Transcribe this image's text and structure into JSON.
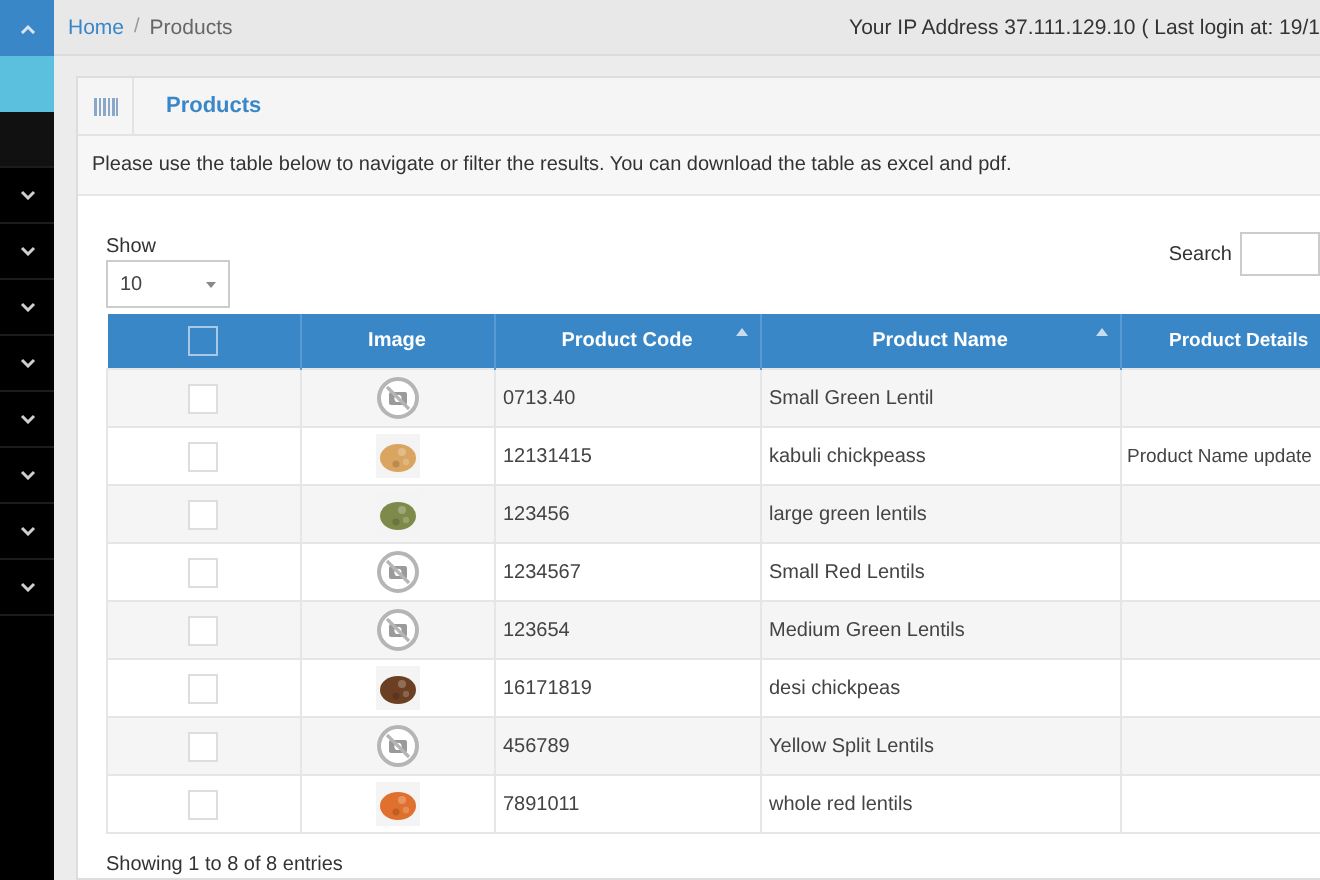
{
  "sidebar": {
    "items": [
      {
        "kind": "collapse"
      },
      {
        "kind": "active"
      },
      {
        "kind": "blank"
      },
      {
        "kind": "menu",
        "expanded": false
      },
      {
        "kind": "menu",
        "expanded": false
      },
      {
        "kind": "menu",
        "expanded": false
      },
      {
        "kind": "menu",
        "expanded": false
      },
      {
        "kind": "menu",
        "expanded": false
      },
      {
        "kind": "menu",
        "expanded": false
      },
      {
        "kind": "menu",
        "expanded": false
      },
      {
        "kind": "menu",
        "expanded": false
      }
    ]
  },
  "breadcrumb": [
    {
      "label": "Home",
      "link": true
    },
    {
      "label": "/",
      "kind": "separator"
    },
    {
      "label": "Products",
      "link": false
    }
  ],
  "login_info": "Your IP Address 37.111.129.10 ( Last login at: 19/1",
  "panel": {
    "title": "Products",
    "description": "Please use the table below to navigate or filter the results. You can download the table as excel and pdf."
  },
  "length_menu": {
    "label": "Show",
    "value": "10"
  },
  "search": {
    "label": "Search"
  },
  "table": {
    "select_all": {
      "checked": false
    },
    "columns": [
      {
        "label": "Image",
        "sortable": false
      },
      {
        "label": "Product Code",
        "sortable": true
      },
      {
        "label": "Product Name",
        "sortable": true
      },
      {
        "label": "Product Details"
      }
    ],
    "rows": [
      {
        "checked": false,
        "image": {
          "kind": "none"
        },
        "code": "0713.40",
        "name": "Small Green Lentil",
        "details": ""
      },
      {
        "checked": false,
        "code": "12131415",
        "name": "kabuli chickpeass",
        "details": "Product Name update"
      },
      {
        "checked": false,
        "code": "123456",
        "name": "large green lentils",
        "details": ""
      },
      {
        "checked": false,
        "image": {
          "kind": "none"
        },
        "code": "1234567",
        "name": "Small Red Lentils",
        "details": ""
      },
      {
        "checked": false,
        "image": {
          "kind": "none"
        },
        "code": "123654",
        "name": "Medium Green Lentils",
        "details": ""
      },
      {
        "checked": false,
        "code": "16171819",
        "name": "desi chickpeas",
        "details": ""
      },
      {
        "checked": false,
        "image": {
          "kind": "none"
        },
        "code": "456789",
        "name": "Yellow Split Lentils",
        "details": ""
      },
      {
        "checked": false,
        "code": "7891011",
        "name": "whole red lentils",
        "details": ""
      }
    ]
  },
  "info": "Showing 1 to 8 of 8 entries"
}
